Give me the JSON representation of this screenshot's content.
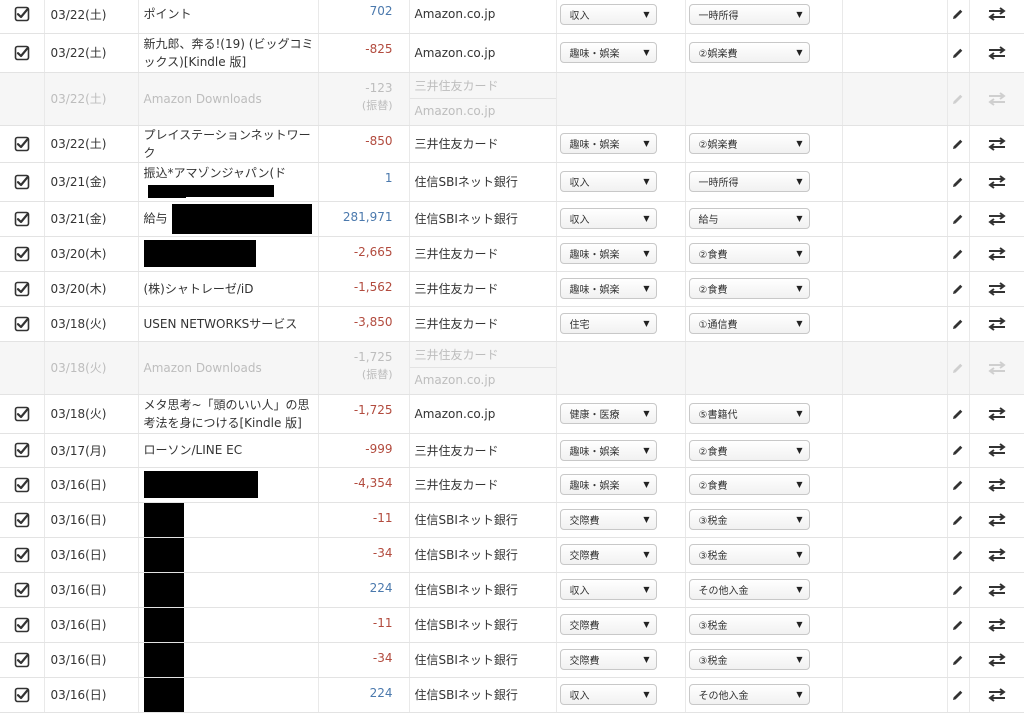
{
  "rows": [
    {
      "date": "03/22(土)",
      "content": "ポイント",
      "amount": "702",
      "sign": "pos",
      "account": "Amazon.co.jp",
      "category": "収入",
      "subcategory": "一時所得",
      "h": 37
    },
    {
      "date": "03/22(土)",
      "content": "新九郎、奔る!(19) (ビッグコミックス)[Kindle 版]",
      "amount": "-825",
      "sign": "neg",
      "account": "Amazon.co.jp",
      "category": "趣味・娯楽",
      "subcategory": "②娯楽費",
      "h": 39
    },
    {
      "transfer": true,
      "date": "03/22(土)",
      "content": "Amazon Downloads",
      "amount": "-123",
      "note": "(振替)",
      "account": "三井住友カード",
      "account2": "Amazon.co.jp",
      "h": 53
    },
    {
      "date": "03/22(土)",
      "content": "プレイステーションネットワーク",
      "amount": "-850",
      "sign": "neg",
      "account": "三井住友カード",
      "category": "趣味・娯楽",
      "subcategory": "②娯楽費",
      "h": 35
    },
    {
      "date": "03/21(金)",
      "content": "振込*アマゾンジャパン(ド",
      "redact": [
        [
          38,
          13
        ],
        [
          88,
          12
        ]
      ],
      "amount": "1",
      "sign": "pos",
      "account": "住信SBIネット銀行",
      "category": "収入",
      "subcategory": "一時所得",
      "h": 39
    },
    {
      "date": "03/21(金)",
      "content": "給与",
      "redact": [
        [
          140,
          30
        ]
      ],
      "amount": "281,971",
      "sign": "pos",
      "account": "住信SBIネット銀行",
      "category": "収入",
      "subcategory": "給与",
      "h": 35
    },
    {
      "date": "03/20(木)",
      "content": "",
      "redact": [
        [
          112,
          27
        ]
      ],
      "amount": "-2,665",
      "sign": "neg",
      "account": "三井住友カード",
      "category": "趣味・娯楽",
      "subcategory": "②食費",
      "h": 35
    },
    {
      "date": "03/20(木)",
      "content": "(株)シャトレーゼ/iD",
      "amount": "-1,562",
      "sign": "neg",
      "account": "三井住友カード",
      "category": "趣味・娯楽",
      "subcategory": "②食費",
      "h": 35
    },
    {
      "date": "03/18(火)",
      "content": "USEN NETWORKSサービス",
      "amount": "-3,850",
      "sign": "neg",
      "account": "三井住友カード",
      "category": "住宅",
      "subcategory": "①通信費",
      "h": 35
    },
    {
      "transfer": true,
      "date": "03/18(火)",
      "content": "Amazon Downloads",
      "amount": "-1,725",
      "note": "(振替)",
      "account": "三井住友カード",
      "account2": "Amazon.co.jp",
      "h": 53
    },
    {
      "date": "03/18(火)",
      "content": "メタ思考~「頭のいい人」の思考法を身につける[Kindle 版]",
      "amount": "-1,725",
      "sign": "neg",
      "account": "Amazon.co.jp",
      "category": "健康・医療",
      "subcategory": "⑤書籍代",
      "h": 39
    },
    {
      "date": "03/17(月)",
      "content": "ローソン/LINE EC",
      "amount": "-999",
      "sign": "neg",
      "account": "三井住友カード",
      "category": "趣味・娯楽",
      "subcategory": "②食費",
      "h": 34
    },
    {
      "date": "03/16(日)",
      "content": "",
      "redact": [
        [
          114,
          27
        ]
      ],
      "amount": "-4,354",
      "sign": "neg",
      "account": "三井住友カード",
      "category": "趣味・娯楽",
      "subcategory": "②食費",
      "h": 35
    },
    {
      "date": "03/16(日)",
      "content": "",
      "redact": [
        [
          40,
          34
        ]
      ],
      "amount": "-11",
      "sign": "neg",
      "account": "住信SBIネット銀行",
      "category": "交際費",
      "subcategory": "③税金",
      "h": 35
    },
    {
      "date": "03/16(日)",
      "content": "",
      "redact": [
        [
          40,
          34
        ]
      ],
      "amount": "-34",
      "sign": "neg",
      "account": "住信SBIネット銀行",
      "category": "交際費",
      "subcategory": "③税金",
      "h": 34
    },
    {
      "date": "03/16(日)",
      "content": "",
      "redact": [
        [
          40,
          34
        ]
      ],
      "amount": "224",
      "sign": "pos",
      "account": "住信SBIネット銀行",
      "category": "収入",
      "subcategory": "その他入金",
      "h": 35
    },
    {
      "date": "03/16(日)",
      "content": "",
      "redact": [
        [
          40,
          34
        ]
      ],
      "amount": "-11",
      "sign": "neg",
      "account": "住信SBIネット銀行",
      "category": "交際費",
      "subcategory": "③税金",
      "h": 35
    },
    {
      "date": "03/16(日)",
      "content": "",
      "redact": [
        [
          40,
          34
        ]
      ],
      "amount": "-34",
      "sign": "neg",
      "account": "住信SBIネット銀行",
      "category": "交際費",
      "subcategory": "③税金",
      "h": 34
    },
    {
      "date": "03/16(日)",
      "content": "",
      "redact": [
        [
          40,
          34
        ]
      ],
      "amount": "224",
      "sign": "pos",
      "account": "住信SBIネット銀行",
      "category": "収入",
      "subcategory": "その他入金",
      "h": 35
    }
  ],
  "icons": {
    "checkbox": "checkbox-checked-icon",
    "edit": "pencil-icon",
    "transfer": "transfer-arrows-icon",
    "caret": "dropdown-caret-icon"
  },
  "colors": {
    "negative": "#b24b3e",
    "positive": "#4b79ad",
    "transfer_text": "#bdbdbd",
    "transfer_bg": "#f6f6f6"
  }
}
